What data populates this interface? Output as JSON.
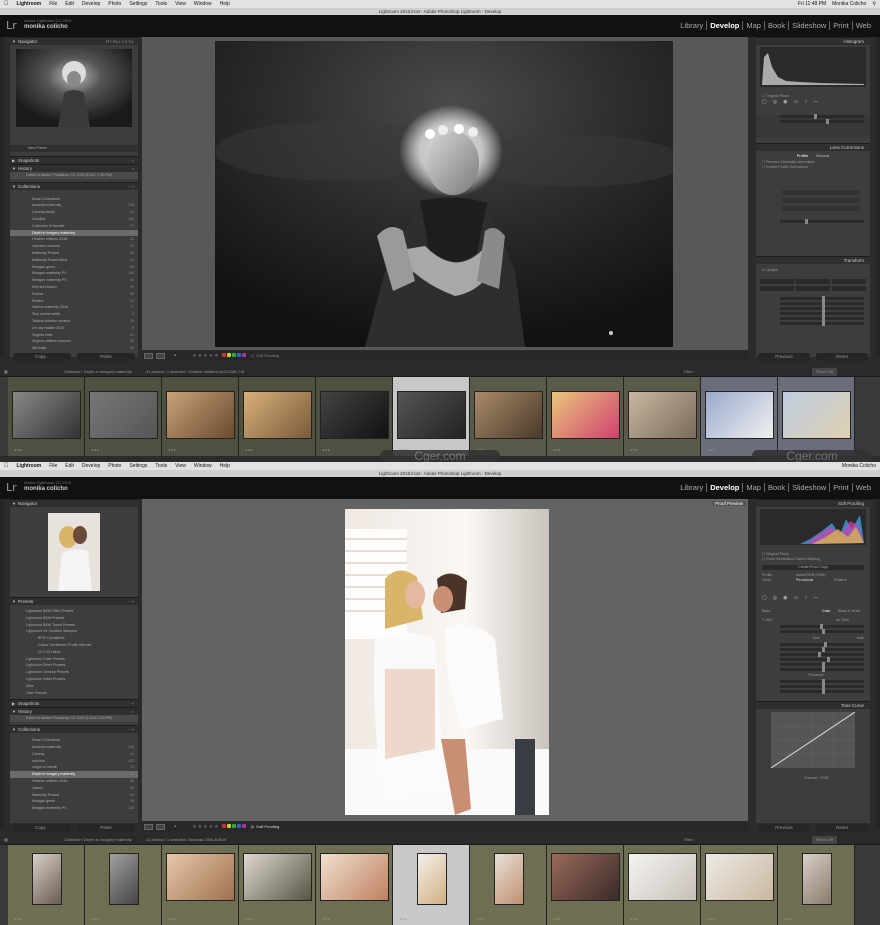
{
  "top": {
    "menubar": {
      "apple": "",
      "items": [
        "Lightroom",
        "File",
        "Edit",
        "Develop",
        "Photo",
        "Settings",
        "Tools",
        "View",
        "Window",
        "Help"
      ],
      "clock": "Fri 11:48 PM",
      "user": "Monika Colicho"
    },
    "title": "Lightroom 2016.lrcat - Adobe Photoshop Lightroom - Develop",
    "identity": {
      "logo": "Lr",
      "version": "Adobe Lightroom CC 2015",
      "user": "monika colicho"
    },
    "modules": [
      "Library",
      "Develop",
      "Map",
      "Book",
      "Slideshow",
      "Print",
      "Web"
    ],
    "left": {
      "navigator": "Navigator",
      "nav_opts": "FIT  FILL  1:1  3:1",
      "new_preset": "New Preset",
      "snapshots": "Snapshots",
      "history": "History",
      "history_item": "Edited in Adobe Photoshop CC 2015 (1/4/17 1:50 PM)",
      "collections": "Collections",
      "items": [
        {
          "n": "Smart Collections",
          "c": ""
        },
        {
          "n": "Amanda maternity",
          "c": "128"
        },
        {
          "n": "Cammy family",
          "c": "91"
        },
        {
          "n": "Carolina",
          "c": "102"
        },
        {
          "n": "Collection of favorite",
          "c": "74"
        },
        {
          "n": "Depth in Imagery maternity",
          "c": "41",
          "sel": true
        },
        {
          "n": "Heather children 2016",
          "c": "52"
        },
        {
          "n": "Jasmine newborn",
          "c": "87"
        },
        {
          "n": "Maternity Poland",
          "c": "64"
        },
        {
          "n": "Maternity Poland Best",
          "c": "23"
        },
        {
          "n": "Meagan green",
          "c": "38"
        },
        {
          "n": "Meagan maternity PV",
          "c": "110"
        },
        {
          "n": "Meagan maternity PV",
          "c": "41"
        },
        {
          "n": "Mini and Marsh",
          "c": "19"
        },
        {
          "n": "Pollina",
          "c": "56"
        },
        {
          "n": "Radica",
          "c": "22"
        },
        {
          "n": "Sabina maternity 2016",
          "c": "77"
        },
        {
          "n": "Sisk central settle",
          "c": "9"
        },
        {
          "n": "Tatiana children session",
          "c": "45"
        },
        {
          "n": "Un day toddler 2016",
          "c": "8"
        },
        {
          "n": "Virginia child",
          "c": "31"
        },
        {
          "n": "Virginia children session",
          "c": "26"
        },
        {
          "n": "Will sella",
          "c": "60"
        }
      ],
      "copy": "Copy...",
      "paste": "Paste"
    },
    "right": {
      "histogram": "Histogram",
      "lens": "Lens Corrections",
      "profile": "Profile",
      "manual": "Manual",
      "transform": "Transform",
      "upright": "Upright",
      "previous": "Previous",
      "reset": "Reset"
    },
    "toolbar": {
      "soft_proofing": "Soft Proofing"
    },
    "filmbar": {
      "path": "Collection: Depth in Imagery maternity",
      "count": "41 photos / 1 selected / Heather children-4422-Edit-7.tif",
      "filter": "Filter :",
      "filter_val": "Filters Off"
    }
  },
  "bottom": {
    "menubar": {
      "apple": "",
      "items": [
        "Lightroom",
        "File",
        "Edit",
        "Develop",
        "Photo",
        "Settings",
        "Tools",
        "View",
        "Window",
        "Help"
      ],
      "user": "Monika Colicho"
    },
    "title": "Lightroom 2016.lrcat - Adobe Photoshop Lightroom - Develop",
    "identity": {
      "logo": "Lr",
      "version": "Adobe Lightroom CC 2015",
      "user": "monika colicho"
    },
    "modules": [
      "Library",
      "Develop",
      "Map",
      "Book",
      "Slideshow",
      "Print",
      "Web"
    ],
    "left": {
      "navigator": "Navigator",
      "presets": "Presets",
      "preset_items": [
        {
          "n": "Lightroom B&W Filter Presets",
          "lvl": 1
        },
        {
          "n": "Lightroom B&W Presets",
          "lvl": 1
        },
        {
          "n": "Lightroom B&W Toned Presets",
          "lvl": 1
        },
        {
          "n": "Lightroom Clr Creative Samples",
          "lvl": 1
        },
        {
          "n": "BFW Carolitteria",
          "lvl": 2
        },
        {
          "n": "Colour Gentlemen Profile Blender",
          "lvl": 2
        },
        {
          "n": "DLC-01 Hikes",
          "lvl": 2
        },
        {
          "n": "Lightroom Color Presets",
          "lvl": 1
        },
        {
          "n": "Lightroom Effect Presets",
          "lvl": 1
        },
        {
          "n": "Lightroom General Presets",
          "lvl": 1
        },
        {
          "n": "Lightroom Video Presets",
          "lvl": 1
        },
        {
          "n": "Mine",
          "lvl": 1
        },
        {
          "n": "User Presets",
          "lvl": 1
        }
      ],
      "snapshots": "Snapshots",
      "history": "History",
      "history_item": "Edited in Adobe Photoshop CC 2015 (1/4/16 3:54 PM)",
      "collections": "Collections",
      "items": [
        {
          "n": "Smart Collections",
          "c": ""
        },
        {
          "n": "Amanda maternity",
          "c": "128"
        },
        {
          "n": "Cammy",
          "c": "91"
        },
        {
          "n": "carolina",
          "c": "102"
        },
        {
          "n": "cmgni of memili",
          "c": "74"
        },
        {
          "n": "Depth in Imagery maternity",
          "c": "41",
          "sel": true
        },
        {
          "n": "Heather children 2016",
          "c": "52"
        },
        {
          "n": "Jasem",
          "c": "87"
        },
        {
          "n": "Maternity Poland",
          "c": "64"
        },
        {
          "n": "Meagan green",
          "c": "38"
        },
        {
          "n": "Meagan maternity PV",
          "c": "110"
        }
      ],
      "copy": "Copy...",
      "paste": "Paste"
    },
    "right": {
      "histogram": "Soft Proofing",
      "proof_preview": "Proof Preview",
      "create_copy": "Create Proof Copy",
      "profile": "Profile",
      "profile_val": "AdobeRGB (1998)",
      "intent": "Intent",
      "perceptual": "Perceptual",
      "relative": "Relative",
      "basic": "Basic",
      "color": "Color",
      "bw": "Black & White",
      "wb": "WB :",
      "as_shot": "As Shot",
      "tone": "Tone",
      "auto": "Auto",
      "presence": "Presence",
      "tone_curve": "Tone Curve",
      "channel": "Channel :",
      "rgb": "RGB",
      "previous": "Previous",
      "reset": "Reset"
    },
    "toolbar": {
      "soft_proofing": "Soft Proofing"
    },
    "filmbar": {
      "path": "Collection: Depth in Imagery maternity",
      "count": "41 photos / 1 selected / Amanda-7054-Edit.tif",
      "filter": "Filter :",
      "filter_val": "Filters Off"
    }
  },
  "watermarks": [
    "Cger.com",
    "Cger.com"
  ],
  "colors": {
    "accent": "#ffffff",
    "panel": "#3d3d3d",
    "background": "#585858",
    "selection_row": "#6a6a6a"
  }
}
